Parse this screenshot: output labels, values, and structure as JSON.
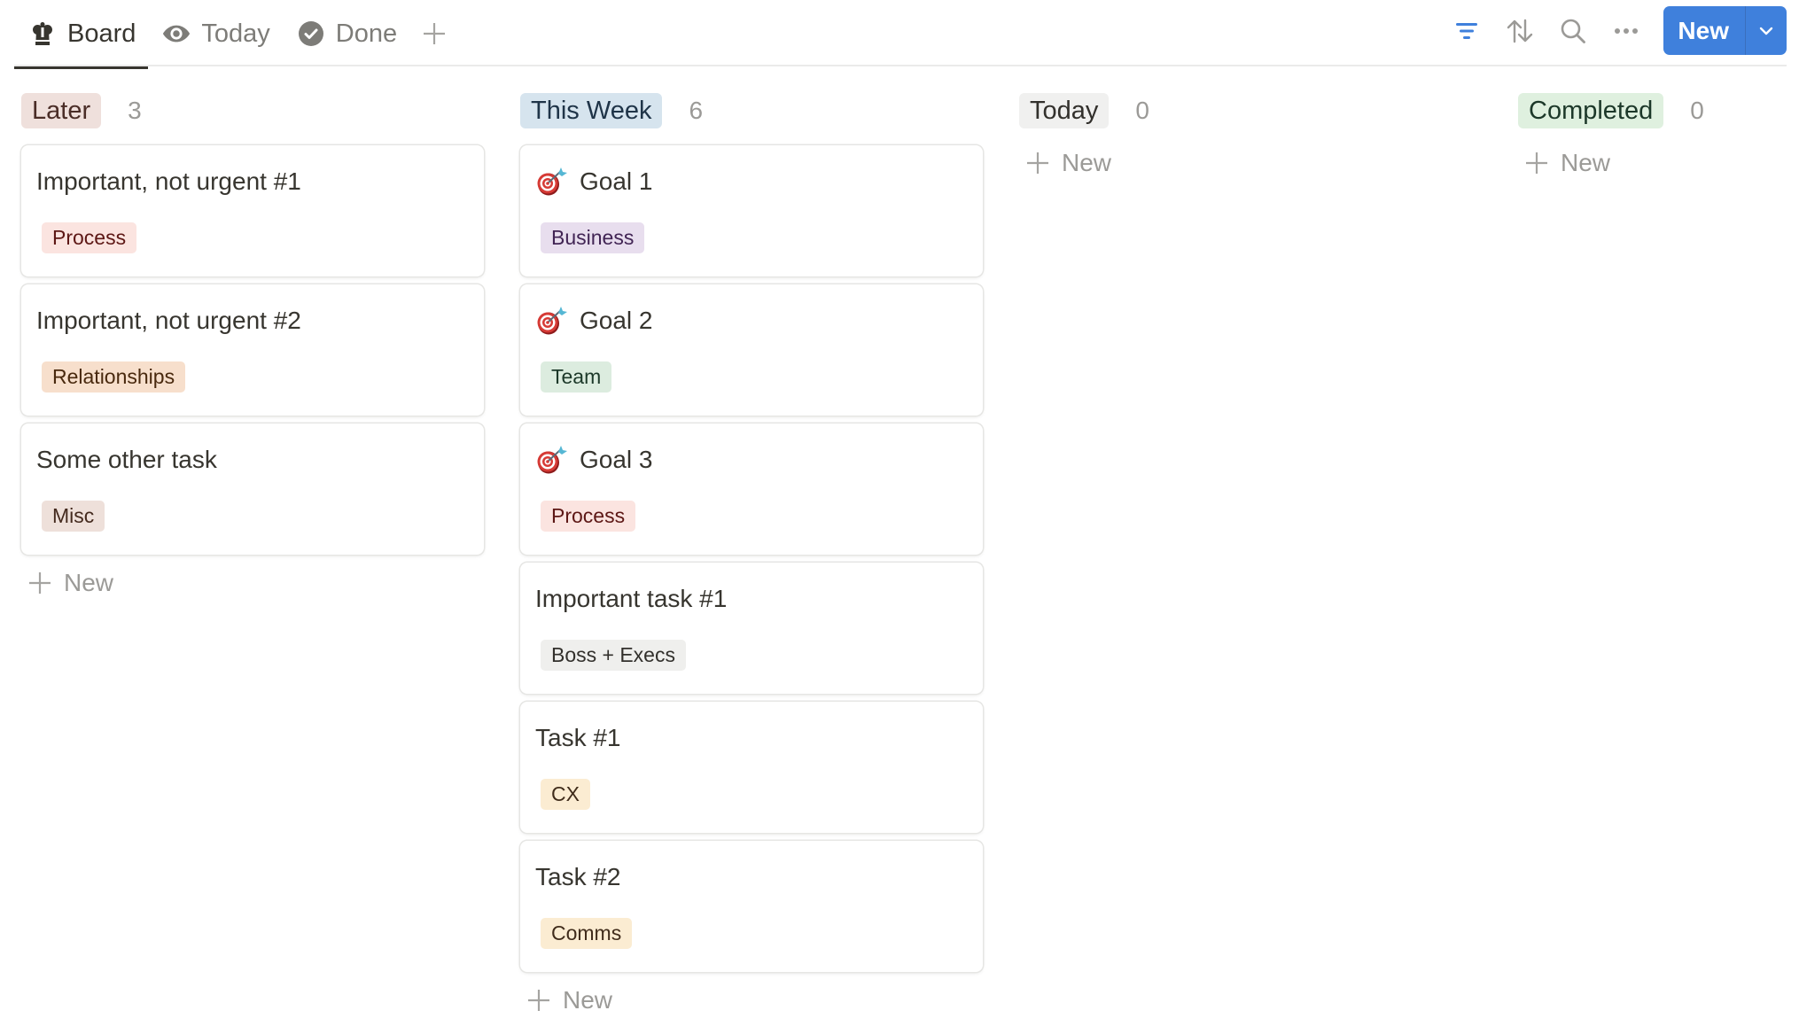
{
  "views": {
    "tabs": [
      {
        "label": "Board",
        "icon": "crown-icon",
        "active": true
      },
      {
        "label": "Today",
        "icon": "eye-icon",
        "active": false
      },
      {
        "label": "Done",
        "icon": "check-circle-icon",
        "active": false
      }
    ],
    "add_view_icon": "plus-icon"
  },
  "toolbar": {
    "filter_icon": "filter-icon",
    "sort_icon": "sort-icon",
    "search_icon": "search-icon",
    "more_icon": "more-icon",
    "new_label": "New",
    "new_dropdown_icon": "chevron-down-icon"
  },
  "colors": {
    "accent": "#3f80dc",
    "filter_active": "#3f80dc"
  },
  "columns": [
    {
      "name": "Later",
      "count": "3",
      "pill_bg": "#efe0dc",
      "pill_fg": "#4a2d27",
      "cards": [
        {
          "title": "Important, not urgent #1",
          "emoji": null,
          "tag": {
            "label": "Process",
            "bg": "#fbe4e0",
            "fg": "#5d1715"
          }
        },
        {
          "title": "Important, not urgent #2",
          "emoji": null,
          "tag": {
            "label": "Relationships",
            "bg": "#f7dfcc",
            "fg": "#49290e"
          }
        },
        {
          "title": "Some other task",
          "emoji": null,
          "tag": {
            "label": "Misc",
            "bg": "#eee0da",
            "fg": "#442a1e"
          }
        }
      ],
      "add_label": "New"
    },
    {
      "name": "This Week",
      "count": "6",
      "pill_bg": "#d6e4ee",
      "pill_fg": "#1f3448",
      "cards": [
        {
          "title": "Goal 1",
          "emoji": "target-icon",
          "tag": {
            "label": "Business",
            "bg": "#e8deee",
            "fg": "#412454"
          }
        },
        {
          "title": "Goal 2",
          "emoji": "target-icon",
          "tag": {
            "label": "Team",
            "bg": "#dcecdf",
            "fg": "#1c3829"
          }
        },
        {
          "title": "Goal 3",
          "emoji": "target-icon",
          "tag": {
            "label": "Process",
            "bg": "#fbe4e0",
            "fg": "#5d1715"
          }
        },
        {
          "title": "Important task #1",
          "emoji": null,
          "tag": {
            "label": "Boss + Execs",
            "bg": "#efefed",
            "fg": "#32302c"
          }
        },
        {
          "title": "Task #1",
          "emoji": null,
          "tag": {
            "label": "CX",
            "bg": "#fbecd2",
            "fg": "#402c1b"
          }
        },
        {
          "title": "Task #2",
          "emoji": null,
          "tag": {
            "label": "Comms",
            "bg": "#fbecd2",
            "fg": "#402c1b"
          }
        }
      ],
      "add_label": "New"
    },
    {
      "name": "Today",
      "count": "0",
      "pill_bg": "#f0f0ef",
      "pill_fg": "#32302c",
      "cards": [],
      "add_label": "New"
    },
    {
      "name": "Completed",
      "count": "0",
      "pill_bg": "#dff0df",
      "pill_fg": "#1c3829",
      "cards": [],
      "add_label": "New"
    }
  ]
}
